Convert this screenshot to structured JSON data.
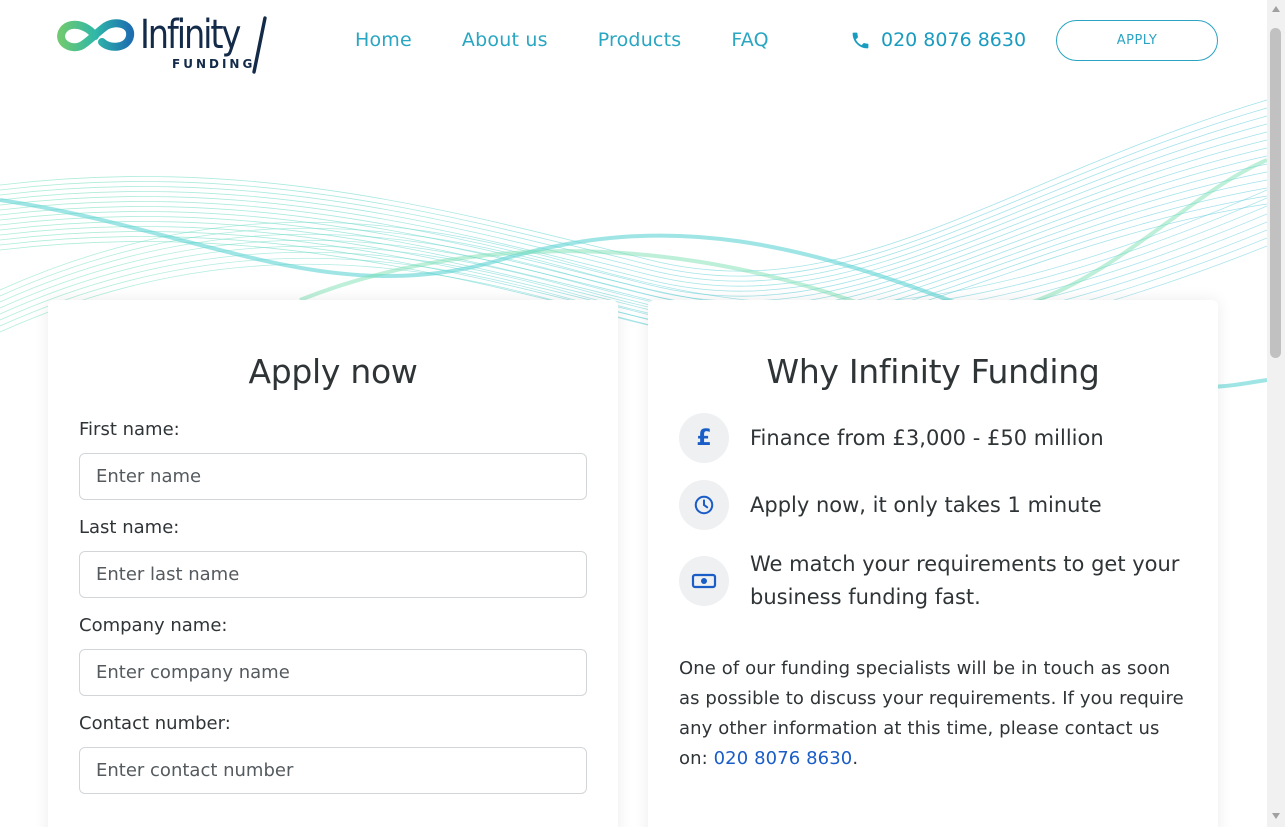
{
  "brand": {
    "name": "Infinity",
    "subtitle": "FUNDING"
  },
  "nav": {
    "items": [
      {
        "label": "Home"
      },
      {
        "label": "About us"
      },
      {
        "label": "Products"
      },
      {
        "label": "FAQ"
      }
    ],
    "phone": "020 8076 8630",
    "apply": "APPLY"
  },
  "apply_form": {
    "title": "Apply now",
    "fields": [
      {
        "label": "First name:",
        "placeholder": "Enter name",
        "value": ""
      },
      {
        "label": "Last name:",
        "placeholder": "Enter last name",
        "value": ""
      },
      {
        "label": "Company name:",
        "placeholder": "Enter company name",
        "value": ""
      },
      {
        "label": "Contact number:",
        "placeholder": "Enter contact number",
        "value": ""
      }
    ]
  },
  "why": {
    "title": "Why Infinity Funding",
    "features": [
      {
        "icon": "pound-icon",
        "symbol": "£",
        "text": "Finance from £3,000 - £50 million"
      },
      {
        "icon": "clock-icon",
        "text": "Apply now, it only takes 1 minute"
      },
      {
        "icon": "banknote-icon",
        "text": "We match your requirements to get your business funding fast."
      }
    ],
    "info": "One of our funding specialists will be in touch as soon as possible to discuss your requirements. If you require any other information at this time, please contact us on: ",
    "info_phone": "020 8076 8630",
    "info_end": "."
  },
  "colors": {
    "accent": "#29a6c2",
    "link": "#1a5dc7",
    "brand_navy": "#132a49",
    "wave_teal": "#5fd3d4",
    "wave_green": "#7be0b4"
  }
}
